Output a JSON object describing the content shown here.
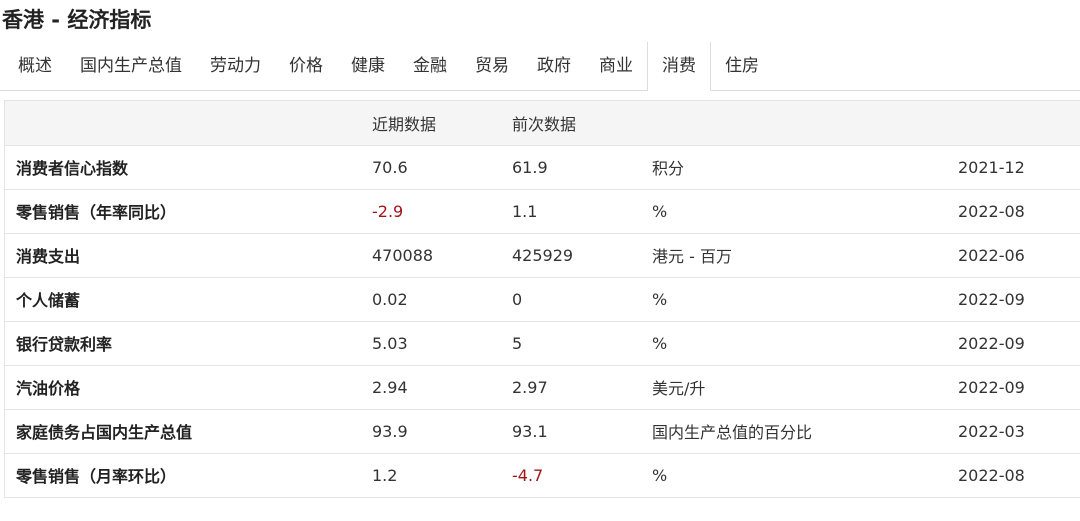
{
  "page": {
    "title": "香港 - 经济指标"
  },
  "tabs": [
    {
      "label": "概述"
    },
    {
      "label": "国内生产总值"
    },
    {
      "label": "劳动力"
    },
    {
      "label": "价格"
    },
    {
      "label": "健康"
    },
    {
      "label": "金融"
    },
    {
      "label": "贸易"
    },
    {
      "label": "政府"
    },
    {
      "label": "商业"
    },
    {
      "label": "消费",
      "active": true
    },
    {
      "label": "住房"
    }
  ],
  "table": {
    "headers": {
      "name": "",
      "recent": "近期数据",
      "previous": "前次数据",
      "unit": "",
      "date": ""
    },
    "rows": [
      {
        "name": "消费者信心指数",
        "recent": "70.6",
        "previous": "61.9",
        "unit": "积分",
        "date": "2021-12"
      },
      {
        "name": "零售销售（年率同比）",
        "recent": "-2.9",
        "previous": "1.1",
        "unit": "%",
        "date": "2022-08"
      },
      {
        "name": "消费支出",
        "recent": "470088",
        "previous": "425929",
        "unit": "港元 - 百万",
        "date": "2022-06"
      },
      {
        "name": "个人储蓄",
        "recent": "0.02",
        "previous": "0",
        "unit": "%",
        "date": "2022-09"
      },
      {
        "name": "银行贷款利率",
        "recent": "5.03",
        "previous": "5",
        "unit": "%",
        "date": "2022-09"
      },
      {
        "name": "汽油价格",
        "recent": "2.94",
        "previous": "2.97",
        "unit": "美元/升",
        "date": "2022-09"
      },
      {
        "name": "家庭债务占国内生产总值",
        "recent": "93.9",
        "previous": "93.1",
        "unit": "国内生产总值的百分比",
        "date": "2022-03"
      },
      {
        "name": "零售销售（月率环比）",
        "recent": "1.2",
        "previous": "-4.7",
        "unit": "%",
        "date": "2022-08"
      }
    ]
  },
  "colors": {
    "negative": "#a31515",
    "header_bg": "#f5f5f5",
    "border": "#e4e4e4"
  }
}
